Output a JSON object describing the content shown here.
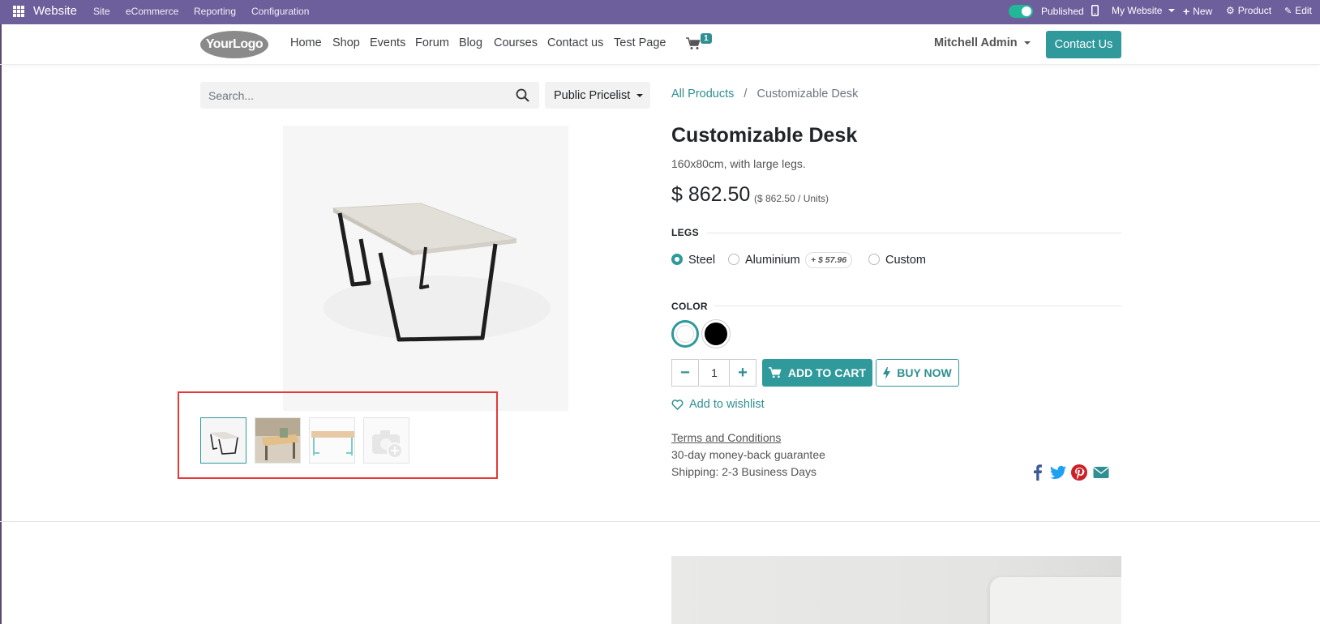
{
  "admin_bar": {
    "brand": "Website",
    "menus": [
      "Site",
      "eCommerce",
      "Reporting",
      "Configuration"
    ],
    "published_label": "Published",
    "my_website_label": "My Website",
    "new_label": "New",
    "product_label": "Product",
    "edit_label": "Edit"
  },
  "header": {
    "logo_text": "YourLogo",
    "nav": [
      "Home",
      "Shop",
      "Events",
      "Forum",
      "Blog",
      "Courses",
      "Contact us",
      "Test Page"
    ],
    "cart_count": "1",
    "user_name": "Mitchell Admin",
    "contact_button": "Contact Us"
  },
  "search": {
    "placeholder": "Search...",
    "pricelist": "Public Pricelist"
  },
  "breadcrumb": {
    "parent": "All Products",
    "separator": "/",
    "current": "Customizable Desk"
  },
  "product": {
    "name": "Customizable Desk",
    "description": "160x80cm, with large legs.",
    "price": "$ 862.50",
    "unit_price": "($ 862.50 / Units)",
    "legs_label": "LEGS",
    "legs_options": [
      {
        "label": "Steel",
        "checked": true
      },
      {
        "label": "Aluminium",
        "checked": false,
        "extra": "+ $ 57.96"
      },
      {
        "label": "Custom",
        "checked": false
      }
    ],
    "color_label": "COLOR",
    "colors": [
      {
        "name": "White",
        "hex": "#ffffff",
        "selected": true
      },
      {
        "name": "Black",
        "hex": "#000000",
        "selected": false
      }
    ],
    "quantity": "1",
    "add_to_cart": "ADD TO CART",
    "buy_now": "BUY NOW",
    "wishlist": "Add to wishlist",
    "terms": "Terms and Conditions",
    "guarantee": "30-day money-back guarantee",
    "shipping": "Shipping: 2-3 Business Days"
  },
  "colors": {
    "admin_bar": "#6d5f9c",
    "primary": "#2f999b",
    "highlight_box": "#e53935",
    "facebook": "#3b5998",
    "twitter": "#1da1f2",
    "pinterest": "#cb2027",
    "email": "#2f8f91"
  }
}
